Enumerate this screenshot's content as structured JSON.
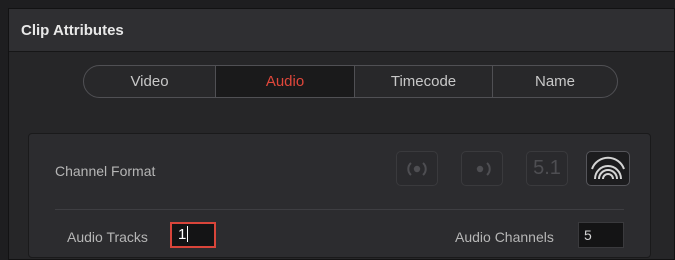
{
  "window": {
    "title": "Clip Attributes"
  },
  "tabs": [
    {
      "label": "Video",
      "active": false
    },
    {
      "label": "Audio",
      "active": true
    },
    {
      "label": "Timecode",
      "active": false
    },
    {
      "label": "Name",
      "active": false
    }
  ],
  "audio": {
    "channel_format_label": "Channel Format",
    "channel_formats": [
      {
        "icon": "stereo-icon",
        "active": false
      },
      {
        "icon": "mono-icon",
        "active": false
      },
      {
        "label": "5.1",
        "active": false
      },
      {
        "icon": "adaptive-icon",
        "active": true
      }
    ],
    "audio_tracks_label": "Audio Tracks",
    "audio_tracks_value": "1",
    "audio_channels_label": "Audio Channels",
    "audio_channels_value": "5"
  },
  "colors": {
    "accent": "#e0473b",
    "background": "#262628",
    "panel": "#2c2c2f"
  }
}
